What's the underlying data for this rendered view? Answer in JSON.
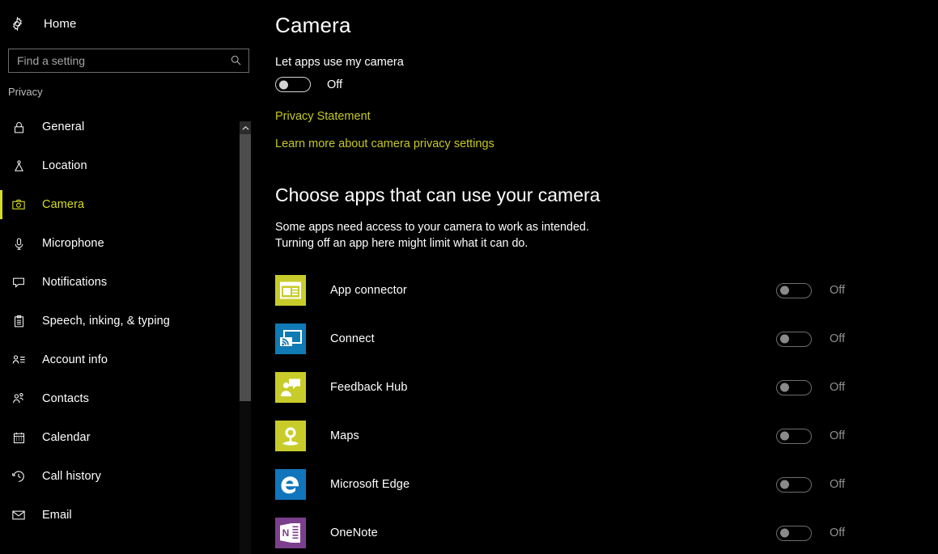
{
  "sidebar": {
    "home": {
      "label": "Home",
      "icon": "gear-icon"
    },
    "search": {
      "placeholder": "Find a setting",
      "value": "",
      "icon": "search-icon"
    },
    "section_label": "Privacy",
    "items": [
      {
        "label": "General",
        "icon": "lock-icon",
        "selected": false
      },
      {
        "label": "Location",
        "icon": "location-icon",
        "selected": false
      },
      {
        "label": "Camera",
        "icon": "camera-icon",
        "selected": true
      },
      {
        "label": "Microphone",
        "icon": "microphone-icon",
        "selected": false
      },
      {
        "label": "Notifications",
        "icon": "speech-icon",
        "selected": false
      },
      {
        "label": "Speech, inking, & typing",
        "icon": "clipboard-icon",
        "selected": false
      },
      {
        "label": "Account info",
        "icon": "account-icon",
        "selected": false
      },
      {
        "label": "Contacts",
        "icon": "contacts-icon",
        "selected": false
      },
      {
        "label": "Calendar",
        "icon": "calendar-icon",
        "selected": false
      },
      {
        "label": "Call history",
        "icon": "history-icon",
        "selected": false
      },
      {
        "label": "Email",
        "icon": "envelope-icon",
        "selected": false
      }
    ],
    "accent_color": "#d6dc20"
  },
  "main": {
    "title": "Camera",
    "master_toggle": {
      "label": "Let apps use my camera",
      "state": "Off"
    },
    "links": [
      {
        "text": "Privacy Statement"
      },
      {
        "text": "Learn more about camera privacy settings"
      }
    ],
    "link_color": "#c5c820",
    "section": {
      "heading": "Choose apps that can use your camera",
      "description_line1": "Some apps need access to your camera to work as intended.",
      "description_line2": "Turning off an app here might limit what it can do."
    },
    "apps": [
      {
        "name": "App connector",
        "state": "Off",
        "icon": "app-connector-icon",
        "tile_color": "#c8cc2a"
      },
      {
        "name": "Connect",
        "state": "Off",
        "icon": "connect-cast-icon",
        "tile_color": "#0f7ab4"
      },
      {
        "name": "Feedback Hub",
        "state": "Off",
        "icon": "feedback-hub-icon",
        "tile_color": "#c8cc2a"
      },
      {
        "name": "Maps",
        "state": "Off",
        "icon": "maps-pin-icon",
        "tile_color": "#c8cc2a"
      },
      {
        "name": "Microsoft Edge",
        "state": "Off",
        "icon": "edge-icon",
        "tile_color": "#1175bc"
      },
      {
        "name": "OneNote",
        "state": "Off",
        "icon": "onenote-icon",
        "tile_color": "#7b3f8c"
      }
    ]
  }
}
